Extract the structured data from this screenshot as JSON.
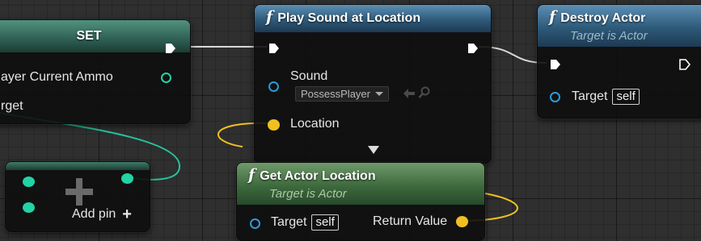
{
  "colors": {
    "exec_wire": "#d8d8d8",
    "vector_pin": "#f0c020",
    "object_pin": "#2b9bd8",
    "int_pin": "#22d3a6"
  },
  "nodes": {
    "set": {
      "title": "SET",
      "pins": {
        "value": "ayer Current Ammo",
        "target": "rget"
      }
    },
    "play_sound": {
      "fn_glyph": "f",
      "title": "Play Sound at Location",
      "pins": {
        "sound": "Sound",
        "sound_value": "PossessPlayer",
        "location": "Location"
      }
    },
    "destroy_actor": {
      "fn_glyph": "f",
      "title": "Destroy Actor",
      "subtitle": "Target is Actor",
      "pins": {
        "target": "Target",
        "target_value": "self"
      }
    },
    "get_actor_location": {
      "fn_glyph": "f",
      "title": "Get Actor Location",
      "subtitle": "Target is Actor",
      "pins": {
        "target": "Target",
        "target_value": "self",
        "return_value": "Return Value"
      }
    },
    "add_node": {
      "add_pin_label": "Add pin",
      "add_pin_glyph": "+"
    }
  }
}
